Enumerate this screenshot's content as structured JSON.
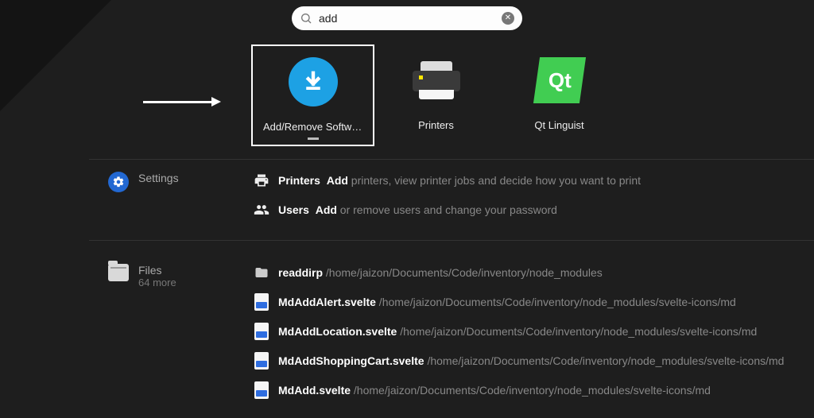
{
  "search": {
    "query": "add"
  },
  "apps": [
    {
      "label": "Add/Remove Software",
      "selected": true,
      "running": true
    },
    {
      "label": "Printers",
      "selected": false,
      "running": false
    },
    {
      "label": "Qt Linguist",
      "selected": false,
      "running": false
    }
  ],
  "settings_section": {
    "label": "Settings",
    "rows": [
      {
        "name_prefix": "Printers",
        "hl": "Add",
        "rest": " printers, view printer jobs and decide how you want to print"
      },
      {
        "name_prefix": "Users",
        "hl": "Add",
        "rest": " or remove users and change your password"
      }
    ]
  },
  "files_section": {
    "label": "Files",
    "sub": "64 more",
    "rows": [
      {
        "kind": "folder",
        "name": "readdirp",
        "path": "/home/jaizon/Documents/Code/inventory/node_modules"
      },
      {
        "kind": "file",
        "name": "MdAddAlert.svelte",
        "path": "/home/jaizon/Documents/Code/inventory/node_modules/svelte-icons/md"
      },
      {
        "kind": "file",
        "name": "MdAddLocation.svelte",
        "path": "/home/jaizon/Documents/Code/inventory/node_modules/svelte-icons/md"
      },
      {
        "kind": "file",
        "name": "MdAddShoppingCart.svelte",
        "path": "/home/jaizon/Documents/Code/inventory/node_modules/svelte-icons/md"
      },
      {
        "kind": "file",
        "name": "MdAdd.svelte",
        "path": "/home/jaizon/Documents/Code/inventory/node_modules/svelte-icons/md"
      }
    ]
  }
}
